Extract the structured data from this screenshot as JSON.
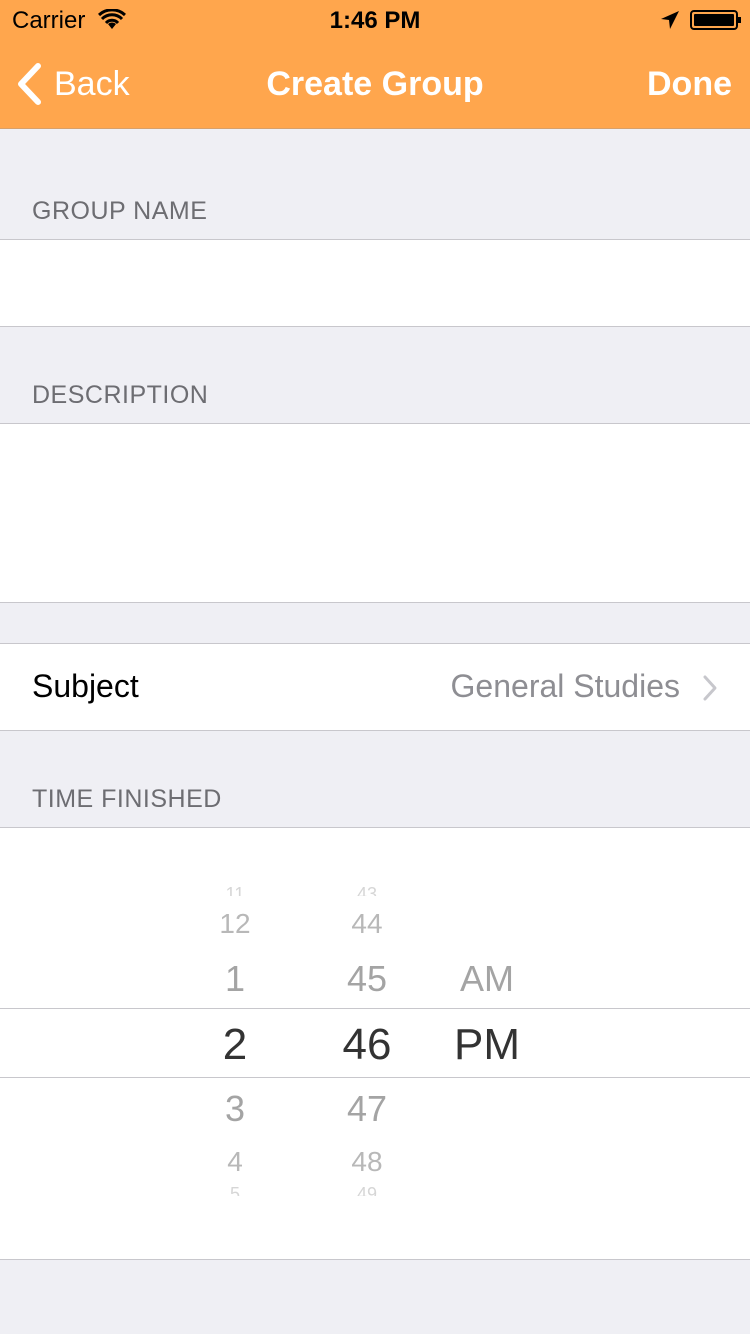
{
  "status_bar": {
    "carrier": "Carrier",
    "time": "1:46 PM"
  },
  "nav": {
    "back_label": "Back",
    "title": "Create Group",
    "done_label": "Done"
  },
  "form": {
    "group_name_header": "GROUP NAME",
    "group_name_value": "",
    "description_header": "DESCRIPTION",
    "description_value": "",
    "subject_label": "Subject",
    "subject_value": "General Studies",
    "time_finished_header": "TIME FINISHED"
  },
  "picker": {
    "hours": [
      "11",
      "12",
      "1",
      "2",
      "3",
      "4",
      "5"
    ],
    "minutes": [
      "43",
      "44",
      "45",
      "46",
      "47",
      "48",
      "49"
    ],
    "periods": [
      "AM",
      "PM"
    ],
    "selected_hour": "2",
    "selected_minute": "46",
    "selected_period": "PM"
  },
  "colors": {
    "accent": "#ffa64d",
    "background": "#efeff4",
    "separator": "#c8c7cc",
    "secondary_text": "#8e8e93"
  }
}
